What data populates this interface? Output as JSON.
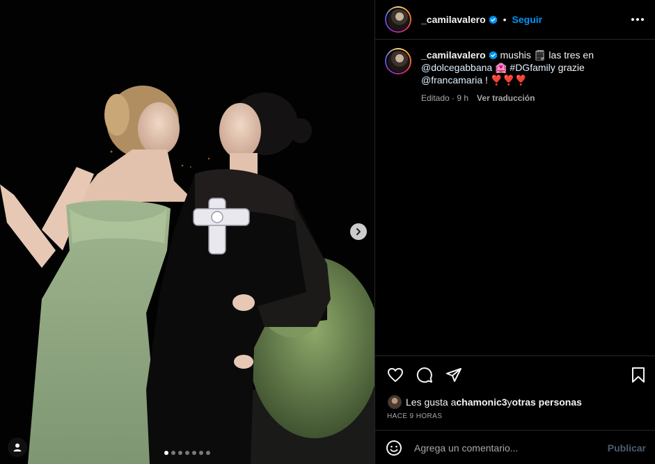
{
  "post": {
    "username": "_camilavalero",
    "follow_label": "Seguir",
    "separator": "•"
  },
  "caption": {
    "username": "_camilavalero",
    "text_1": " mushis ",
    "emoji_1": "🗒",
    "text_2": " las tres en ",
    "mention_1": "@dolcegabbana",
    "emoji_2": " 🏩 ",
    "hashtag": "#DGfamily",
    "text_3": " grazie ",
    "mention_2": "@francamaria",
    "text_4": " ! ",
    "hearts": "❣️❣️❣️",
    "edited": "Editado · 9 h",
    "translate": "Ver traducción"
  },
  "likes": {
    "prefix": "Les gusta a ",
    "user": "chamonic3",
    "mid": " y ",
    "others": "otras personas"
  },
  "timestamp": "HACE 9 HORAS",
  "comment": {
    "placeholder": "Agrega un comentario...",
    "publish_label": "Publicar"
  },
  "carousel": {
    "total": 7,
    "current": 1
  },
  "colors": {
    "accent": "#0095f6",
    "background": "#000000",
    "border": "#262626"
  },
  "icons": [
    "chevron-right-icon",
    "user-tag-icon",
    "verified-icon",
    "more-icon",
    "heart-icon",
    "comment-icon",
    "share-icon",
    "bookmark-icon",
    "emoji-icon"
  ]
}
